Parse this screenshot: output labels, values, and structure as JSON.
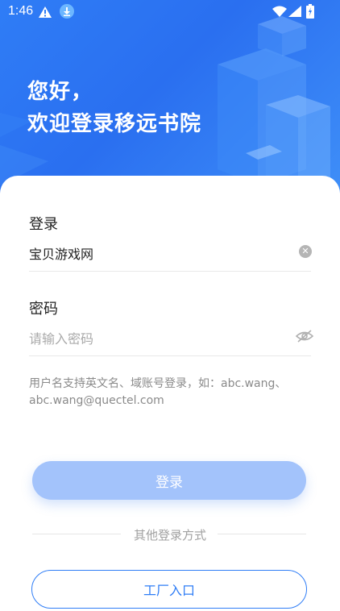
{
  "status_bar": {
    "time": "1:46",
    "icons": [
      "warning-icon",
      "download-icon",
      "wifi-icon",
      "signal-icon",
      "battery-icon"
    ]
  },
  "hero": {
    "greeting_line1": "您好，",
    "greeting_line2": "欢迎登录移远书院"
  },
  "form": {
    "username_label": "登录",
    "username_value": "宝贝游戏网",
    "password_label": "密码",
    "password_placeholder": "请输入密码",
    "hint": "用户名支持英文名、域账号登录，如：abc.wang、abc.wang@quectel.com"
  },
  "actions": {
    "login_label": "登录",
    "other_methods": "其他登录方式",
    "factory_label": "工厂入口"
  },
  "colors": {
    "brand": "#2f7df6",
    "login_disabled": "#a3c3fb"
  }
}
